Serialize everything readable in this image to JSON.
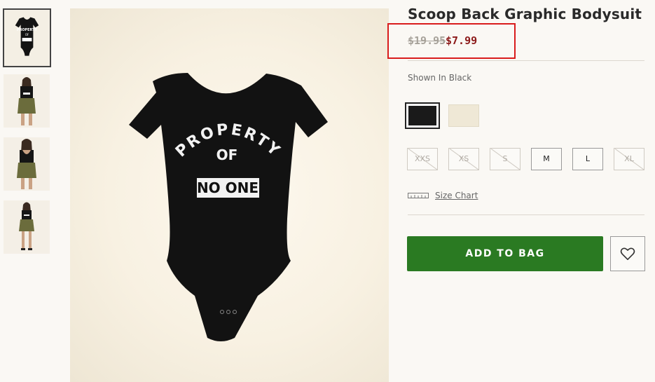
{
  "product": {
    "title": "Scoop Back Graphic Bodysuit",
    "price_original": "$19.95",
    "price_sale": "$7.99",
    "color_label": "Shown In Black"
  },
  "image": {
    "graphic_line1": "PROPERTY",
    "graphic_line2": "OF",
    "graphic_line3": "NO ONE"
  },
  "thumbnails": [
    {
      "name": "bodysuit flat",
      "selected": true
    },
    {
      "name": "model front",
      "selected": false
    },
    {
      "name": "model back",
      "selected": false
    },
    {
      "name": "model full",
      "selected": false
    }
  ],
  "swatches": [
    {
      "color": "#1a1a1a",
      "selected": true
    },
    {
      "color": "#efe8d6",
      "selected": false
    }
  ],
  "sizes": [
    {
      "label": "XXS",
      "available": false
    },
    {
      "label": "XS",
      "available": false
    },
    {
      "label": "S",
      "available": false
    },
    {
      "label": "M",
      "available": true
    },
    {
      "label": "L",
      "available": true
    },
    {
      "label": "XL",
      "available": false
    }
  ],
  "size_chart_label": "Size Chart",
  "add_to_bag_label": "ADD TO BAG",
  "colors": {
    "accent_green": "#2a7a22",
    "sale_red": "#8c1a1a",
    "highlight_red": "#d91c1c"
  },
  "icons": {
    "size_chart": "ruler-icon",
    "wishlist": "heart-icon"
  }
}
